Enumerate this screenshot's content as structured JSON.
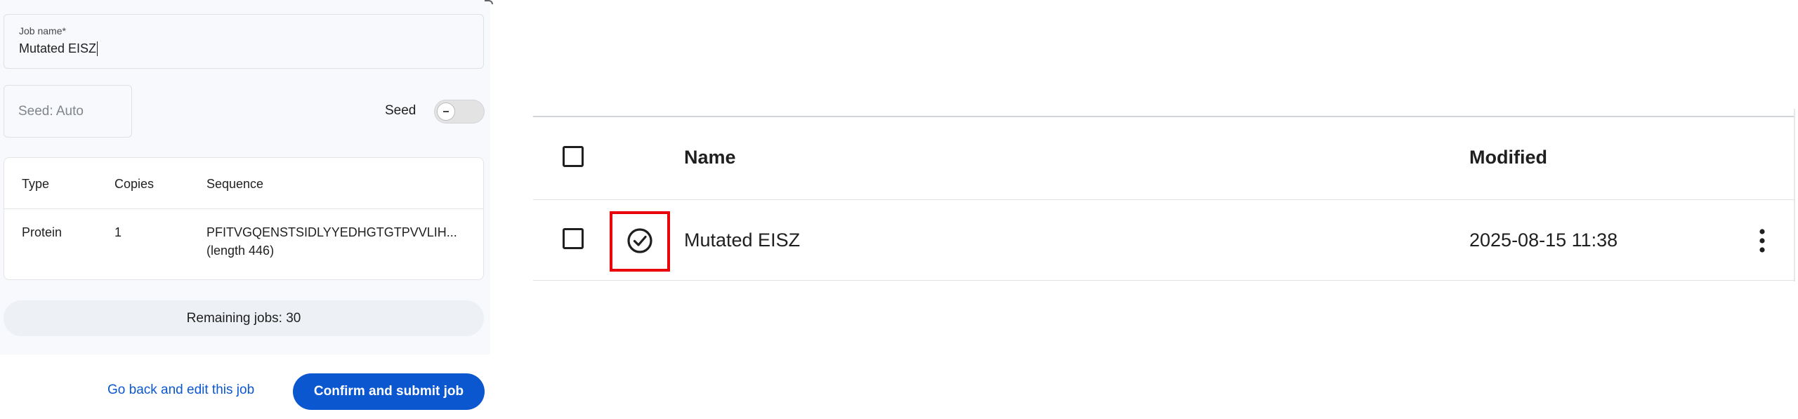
{
  "dialog": {
    "job_name_label": "Job name*",
    "job_name_value": "Mutated EISZ",
    "seed_placeholder": "Seed: Auto",
    "seed_label": "Seed",
    "seed_toggle_on": false,
    "table": {
      "headers": [
        "Type",
        "Copies",
        "Sequence"
      ],
      "rows": [
        {
          "type": "Protein",
          "copies": "1",
          "sequence": "PFITVGQENSTSIDLYYEDHGTGTPVVLIH...",
          "length": "(length 446)"
        }
      ]
    },
    "remaining_jobs": "Remaining jobs: 30",
    "go_back_label": "Go back and edit this job",
    "submit_label": "Confirm and submit job"
  },
  "file_list": {
    "headers": {
      "name": "Name",
      "modified": "Modified"
    },
    "rows": [
      {
        "status_icon": "check-circle-icon",
        "name": "Mutated EISZ",
        "modified": "2025-08-15 11:38",
        "menu_icon": "more-vert-icon"
      }
    ],
    "highlight_color": "#e8000b"
  },
  "colors": {
    "primary": "#0b57d0",
    "panel_bg": "#f8f9fc"
  }
}
